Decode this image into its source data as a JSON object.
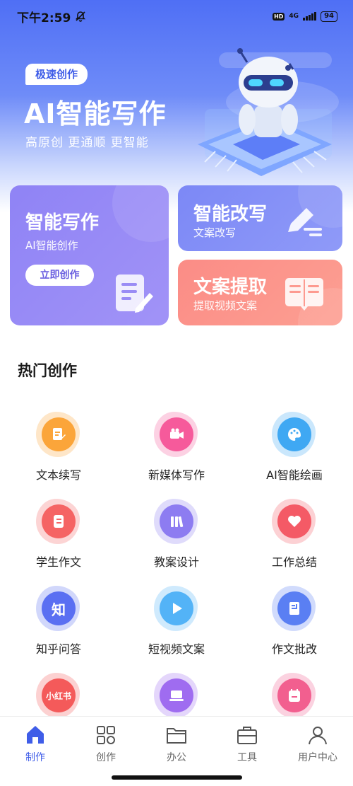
{
  "status": {
    "time": "下午2:59",
    "hd": "HD",
    "network": "4G",
    "battery": "94"
  },
  "hero": {
    "tag": "极速创作",
    "title": "AI智能写作",
    "subtitle": "高原创  更通顺  更智能"
  },
  "cards": {
    "write": {
      "title": "智能写作",
      "subtitle": "AI智能创作",
      "button": "立即创作"
    },
    "rewrite": {
      "title": "智能改写",
      "subtitle": "文案改写"
    },
    "extract": {
      "title": "文案提取",
      "subtitle": "提取视频文案"
    }
  },
  "section": {
    "title": "热门创作"
  },
  "grid": [
    {
      "label": "文本续写",
      "icon": "document-edit-icon",
      "color": "#fba53a"
    },
    {
      "label": "新媒体写作",
      "icon": "video-camera-icon",
      "color": "#f65a9b"
    },
    {
      "label": "AI智能绘画",
      "icon": "palette-icon",
      "color": "#3fa8f3"
    },
    {
      "label": "学生作文",
      "icon": "notebook-icon",
      "color": "#f56464"
    },
    {
      "label": "教案设计",
      "icon": "books-icon",
      "color": "#8d7cf1"
    },
    {
      "label": "工作总结",
      "icon": "heart-icon",
      "color": "#f45a66"
    },
    {
      "label": "知乎问答",
      "icon": "zhihu-icon",
      "color": "#5a6ff2",
      "glyph": "知"
    },
    {
      "label": "短视频文案",
      "icon": "play-icon",
      "color": "#53b3f7"
    },
    {
      "label": "作文批改",
      "icon": "doc-check-icon",
      "color": "#5a7ff3"
    },
    {
      "label": "",
      "icon": "xiaohongshu-icon",
      "color": "#f45a5a",
      "glyph": "小红书"
    },
    {
      "label": "",
      "icon": "laptop-icon",
      "color": "#9f6cf0"
    },
    {
      "label": "",
      "icon": "calendar-icon",
      "color": "#f25f8f"
    }
  ],
  "tabs": [
    {
      "label": "制作",
      "icon": "home-icon",
      "active": true
    },
    {
      "label": "创作",
      "icon": "grid-icon",
      "active": false
    },
    {
      "label": "办公",
      "icon": "folder-icon",
      "active": false
    },
    {
      "label": "工具",
      "icon": "toolbox-icon",
      "active": false
    },
    {
      "label": "用户中心",
      "icon": "user-icon",
      "active": false
    }
  ],
  "colors": {
    "brand": "#3f5de8",
    "active_tab": "#3f5de8"
  }
}
